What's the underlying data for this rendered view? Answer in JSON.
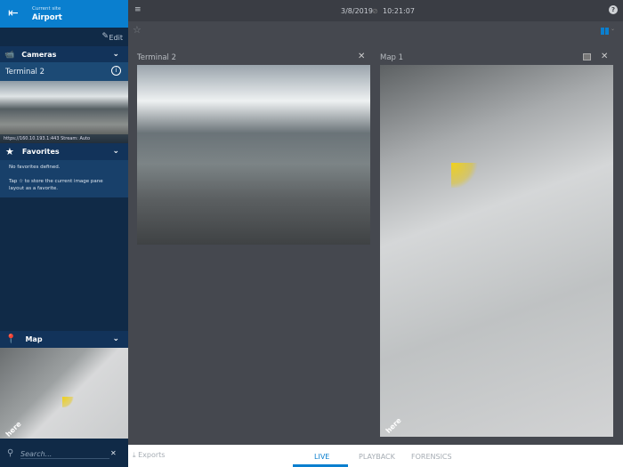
{
  "sidebar": {
    "site_label": "Current site",
    "site_name": "Airport",
    "edit_label": "Edit",
    "cameras_label": "Cameras",
    "camera_item": "Terminal 2",
    "camera_url": "https://160.10.193.1:443 Stream: Auto",
    "favorites_label": "Favorites",
    "favorites_empty": "No favorites defined.",
    "favorites_tip_pre": "Tap",
    "favorites_tip_post": "to store the current image pane layout as a favorite.",
    "map_label": "Map",
    "map_watermark": "here",
    "search_placeholder": "Search..."
  },
  "topbar": {
    "date": "3/8/2019",
    "time": "10:21:07"
  },
  "panes": {
    "camera_title": "Terminal 2",
    "map_title": "Map 1",
    "map_watermark": "here"
  },
  "bottom": {
    "exports": "Exports",
    "tabs": [
      "LIVE",
      "PLAYBACK",
      "FORENSICS"
    ],
    "active": "LIVE"
  },
  "colors": {
    "accent": "#0a7fcf"
  }
}
